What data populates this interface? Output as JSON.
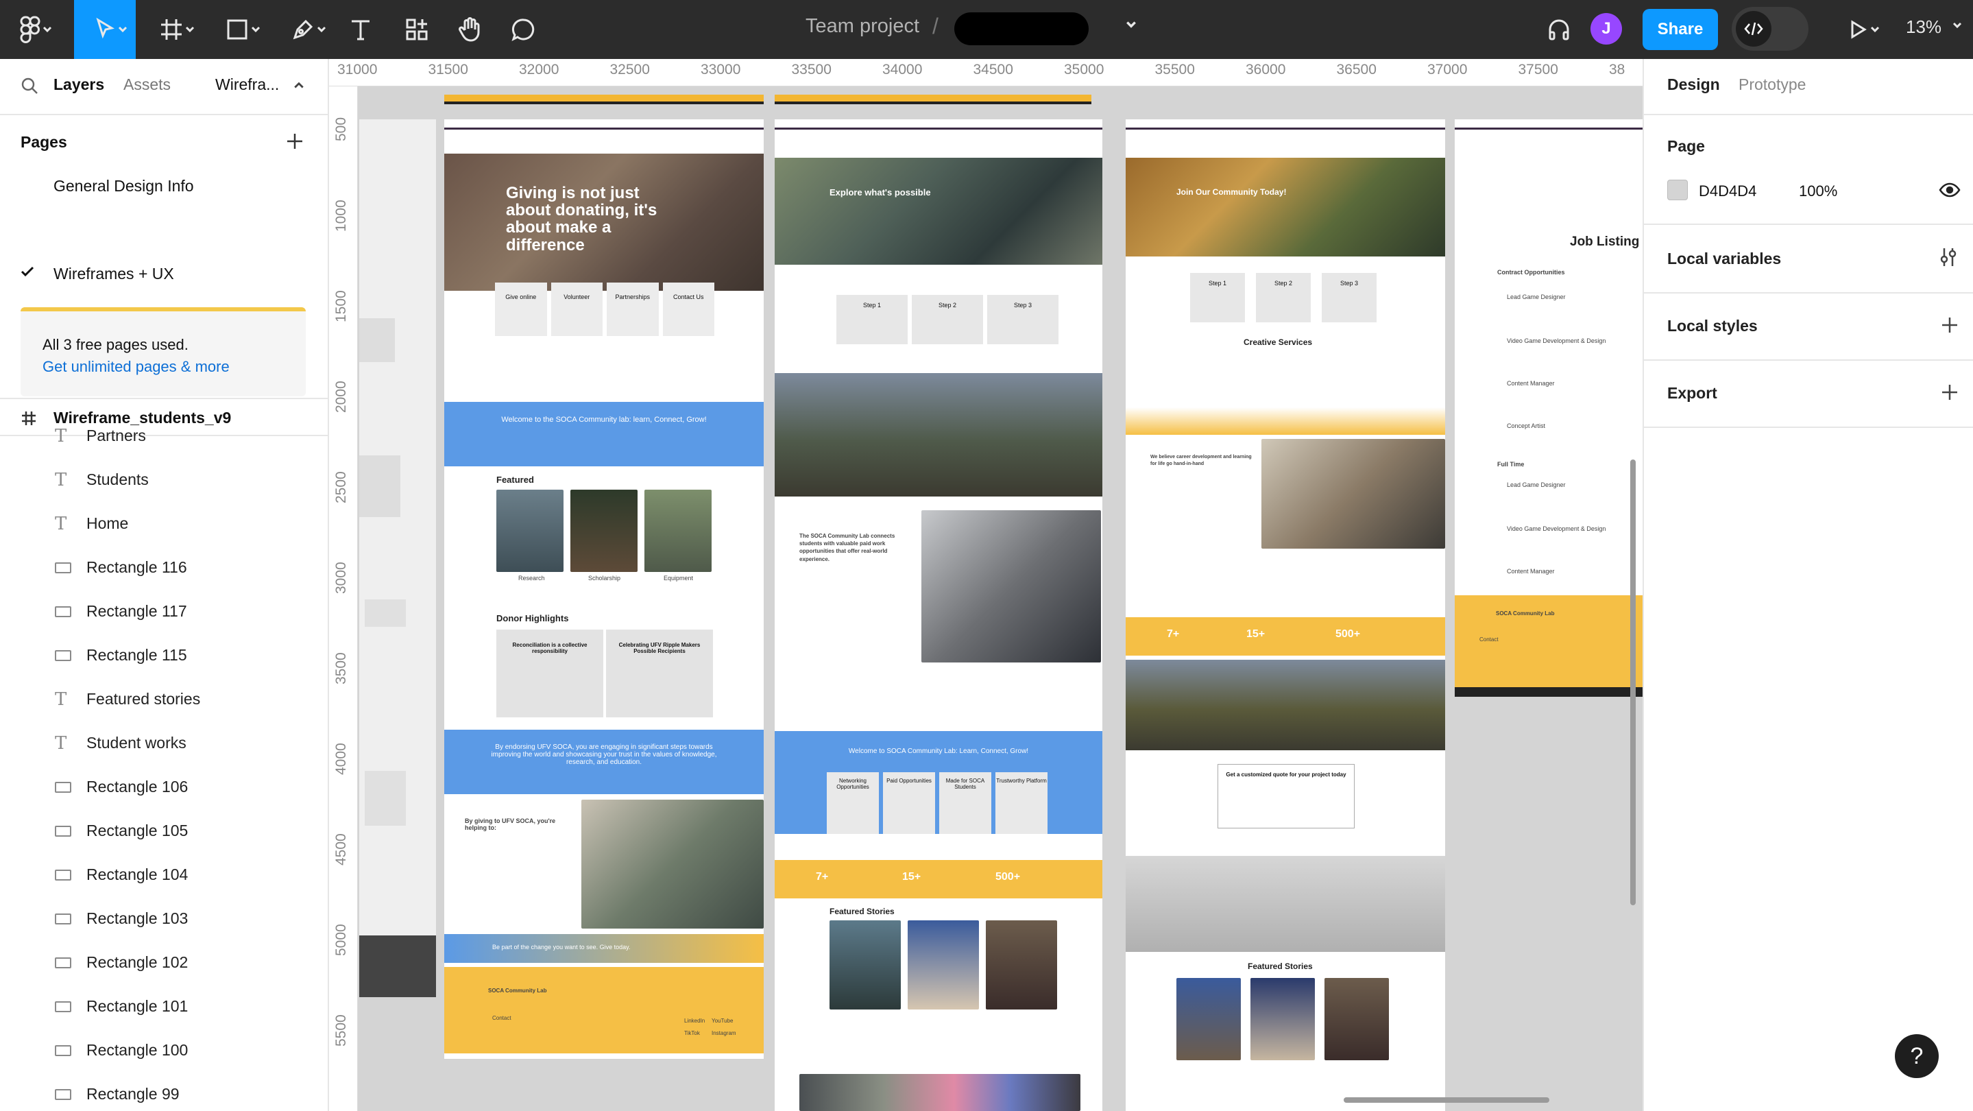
{
  "topbar": {
    "project_name": "Team project",
    "slash": "/",
    "avatar_initial": "J",
    "share_label": "Share",
    "zoom": "13%"
  },
  "left_panel": {
    "tabs": {
      "layers": "Layers",
      "assets": "Assets",
      "page": "Wirefra..."
    },
    "pages_title": "Pages",
    "pages": [
      "General Design Info",
      "Wireframes + UX"
    ],
    "banner": {
      "text": "All 3 free pages used.",
      "link": "Get unlimited pages & more"
    },
    "layer_root": "Wireframe_students_v9",
    "layers": [
      {
        "name": "Partners",
        "type": "text"
      },
      {
        "name": "Students",
        "type": "text"
      },
      {
        "name": "Home",
        "type": "text"
      },
      {
        "name": "Rectangle 116",
        "type": "rect"
      },
      {
        "name": "Rectangle 117",
        "type": "rect"
      },
      {
        "name": "Rectangle 115",
        "type": "rect"
      },
      {
        "name": "Featured stories",
        "type": "text"
      },
      {
        "name": "Student works",
        "type": "text"
      },
      {
        "name": "Rectangle 106",
        "type": "rect"
      },
      {
        "name": "Rectangle 105",
        "type": "rect"
      },
      {
        "name": "Rectangle 104",
        "type": "rect"
      },
      {
        "name": "Rectangle 103",
        "type": "rect"
      },
      {
        "name": "Rectangle 102",
        "type": "rect"
      },
      {
        "name": "Rectangle 101",
        "type": "rect"
      },
      {
        "name": "Rectangle 100",
        "type": "rect"
      },
      {
        "name": "Rectangle 99",
        "type": "rect"
      }
    ]
  },
  "ruler": {
    "top": [
      "31000",
      "31500",
      "32000",
      "32500",
      "33000",
      "33500",
      "34000",
      "34500",
      "35000",
      "35500",
      "36000",
      "36500",
      "37000",
      "37500",
      "38"
    ],
    "left": [
      "500",
      "1000",
      "1500",
      "2000",
      "2500",
      "3000",
      "3500",
      "4000",
      "4500",
      "5000",
      "5500"
    ]
  },
  "canvas": {
    "frame1": {
      "hero": "Giving is not just about donating, it's about make a difference",
      "cards": [
        "Give online",
        "Volunteer",
        "Partnerships",
        "Contact Us"
      ],
      "welcome": "Welcome to the SOCA Community lab: learn, Connect, Grow!",
      "featured": "Featured",
      "featured_tags": [
        "Research",
        "Scholarship",
        "Equipment"
      ],
      "donor": "Donor Highlights",
      "donor_cards": [
        "Reconciliation is a collective responsibility",
        "Celebrating UFV Ripple Makers Possible Recipients"
      ],
      "engage": "By endorsing UFV SOCA, you are engaging in significant steps towards improving the world and showcasing your trust in the values of knowledge, research, and education.",
      "why": "By giving to UFV SOCA, you're helping to:",
      "cta": "Be part of the change you want to see. Give today.",
      "footer_title": "SOCA Community Lab",
      "footer_contact": "Contact",
      "footer_links": [
        "LinkedIn",
        "YouTube",
        "TikTok",
        "Instagram"
      ]
    },
    "frame2": {
      "hero": "Explore what's possible",
      "steps": [
        "Step 1",
        "Step 2",
        "Step 3"
      ],
      "connect": "The SOCA Community Lab connects students with valuable paid work opportunities that offer real-world experience.",
      "welcome": "Welcome to SOCA Community Lab: Learn, Connect, Grow!",
      "cards": [
        "Networking Opportunities",
        "Paid Opportunities",
        "Made for SOCA Students",
        "Trustworthy Platform"
      ],
      "stats": [
        "7+",
        "15+",
        "500+"
      ],
      "featured": "Featured Stories"
    },
    "frame3": {
      "hero": "Join Our Community Today!",
      "steps": [
        "Step 1",
        "Step 2",
        "Step 3"
      ],
      "services": "Creative Services",
      "belief": "We believe career development and learning for life go hand-in-hand",
      "stats": [
        "7+",
        "15+",
        "500+"
      ],
      "quote_title": "Get a customized quote for your project today",
      "featured": "Featured Stories"
    },
    "frame4": {
      "title": "Job Listing",
      "contract": "Contract Opportunities",
      "jobs": [
        "Lead Game Designer",
        "Video Game Development & Design",
        "Content Manager",
        "Concept Artist"
      ],
      "full_time": "Full Time",
      "footer_title": "SOCA Community Lab",
      "footer_contact": "Contact"
    }
  },
  "right_panel": {
    "tabs": {
      "design": "Design",
      "prototype": "Prototype"
    },
    "page_title": "Page",
    "page_color": "D4D4D4",
    "page_opacity": "100%",
    "local_variables": "Local variables",
    "local_styles": "Local styles",
    "export": "Export"
  },
  "help": "?",
  "colors": {
    "accent": "#0d99ff",
    "gold": "#f5bf45",
    "blue": "#5b9ae6",
    "canvas": "#d4d4d4",
    "avatar": "#9747ff"
  }
}
